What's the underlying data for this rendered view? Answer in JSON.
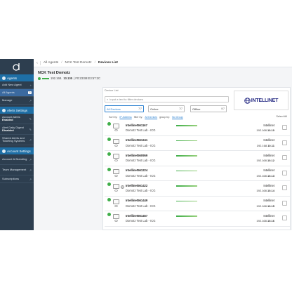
{
  "sidebar": {
    "agents_label": "Agents",
    "items": [
      {
        "label": "Add New Agent"
      },
      {
        "label": "All Agents",
        "count": "2"
      },
      {
        "label": "Manage"
      }
    ],
    "alerts_label": "Alerts Settings",
    "alert_items": [
      {
        "label": "Account Alerts",
        "value": "Enabled"
      },
      {
        "label": "Alert Daily Digest",
        "value": "Disabled"
      },
      {
        "label": "Shared Alerts and Ticketing Systems"
      }
    ],
    "account_label": "Account Settings",
    "account_items": [
      {
        "label": "Account & Branding"
      },
      {
        "label": "Team Management"
      },
      {
        "label": "Subscriptions"
      }
    ]
  },
  "breadcrumb": {
    "items": [
      "All Agents",
      "NCK Test Domotz",
      "Devices List"
    ]
  },
  "agent": {
    "name": "NCK Test Domotz",
    "ip_prefix": "192.168.",
    "ip_bold": "10.105",
    "mac": "| F0:23:B9:E3:57:2C"
  },
  "device_list": {
    "title": "Device List",
    "filter_placeholder": "Input a text to filter devices",
    "selects": [
      {
        "label": "All Devices",
        "count": "7/7"
      },
      {
        "label": "Online",
        "count": "7/7"
      },
      {
        "label": "Offline",
        "count": "0/7"
      }
    ],
    "sort_prefix": "Sort by:",
    "sort_value": "IP Address",
    "filter_prefix": "filter by:",
    "filter_value": "All Devices",
    "group_prefix": "group by:",
    "group_value": "No Group",
    "select_all": "Select All",
    "brand_logo": "INTELLINET",
    "rows": [
      {
        "name": "Intellinet561167",
        "site": "Domotz Test Lab - ICG",
        "vendor": "Intellinet",
        "ip_prefix": "192.168.",
        "ip_bold": "10.10",
        "status": "ok",
        "tag": "",
        "rank": ""
      },
      {
        "name": "Intellinet561241",
        "site": "Domotz Test Lab - ICG",
        "vendor": "Intellinet",
        "ip_prefix": "192.168.",
        "ip_bold": "10.11",
        "status": "ok",
        "tag": "",
        "rank": ""
      },
      {
        "name": "Intellinet560959",
        "site": "Domotz Test Lab - ICG",
        "vendor": "Intellinet",
        "ip_prefix": "192.168.",
        "ip_bold": "10.12",
        "status": "ok",
        "tag": "",
        "rank": ""
      },
      {
        "name": "Intellinet561224",
        "site": "Domotz Test Lab - ICG",
        "vendor": "Intellinet",
        "ip_prefix": "192.168.",
        "ip_bold": "10.13",
        "status": "ok",
        "tag": "",
        "rank": ""
      },
      {
        "name": "Intellinet561422",
        "site": "Domotz Test Lab - ICG",
        "vendor": "Intellinet",
        "ip_prefix": "192.168.",
        "ip_bold": "10.14",
        "status": "ok",
        "tag": "",
        "rank": "0"
      },
      {
        "name": "Intellinet561449",
        "site": "Domotz Test Lab - ICG",
        "vendor": "Intellinet",
        "ip_prefix": "192.168.",
        "ip_bold": "10.15",
        "status": "ok",
        "tag": "",
        "rank": ""
      },
      {
        "name": "Intellinet561457",
        "site": "Domotz Test Lab - ICG",
        "vendor": "Intellinet",
        "ip_prefix": "192.168.",
        "ip_bold": "10.16",
        "status": "ok",
        "tag": "",
        "rank": ""
      }
    ]
  },
  "colors": {
    "sidebar_bg": "#2d3e4f",
    "accent_blue": "#2e82d0",
    "online_green": "#3fae49",
    "brand_navy": "#2a2f86"
  }
}
